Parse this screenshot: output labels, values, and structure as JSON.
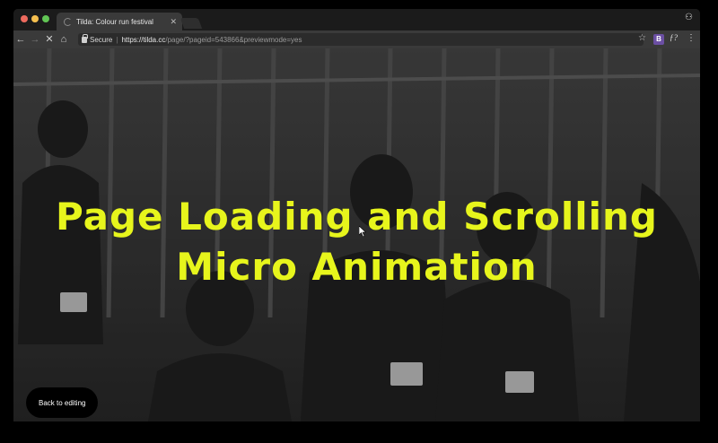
{
  "browser": {
    "tab_title": "Tilda: Colour run festival",
    "tab_close": "✕",
    "address": {
      "secure_label": "Secure",
      "separator": "|",
      "url_host": "https://tilda.cc",
      "url_path": "/page/?pageid=543866&previewmode=yes"
    },
    "nav": {
      "back": "←",
      "forward": "→",
      "stop": "✕",
      "home": "⌂"
    },
    "toolbar_icons": {
      "star": "☆",
      "ext_b": "B",
      "ext_f": "ƒ?",
      "menu": "⋮",
      "profile": "⚇"
    }
  },
  "page": {
    "hero_title_line1": "Page Loading and Scrolling",
    "hero_title_line2": "Micro Animation",
    "back_button_label": "Back to editing"
  },
  "colors": {
    "accent": "#e7f51c",
    "background": "#3c3c3c"
  }
}
